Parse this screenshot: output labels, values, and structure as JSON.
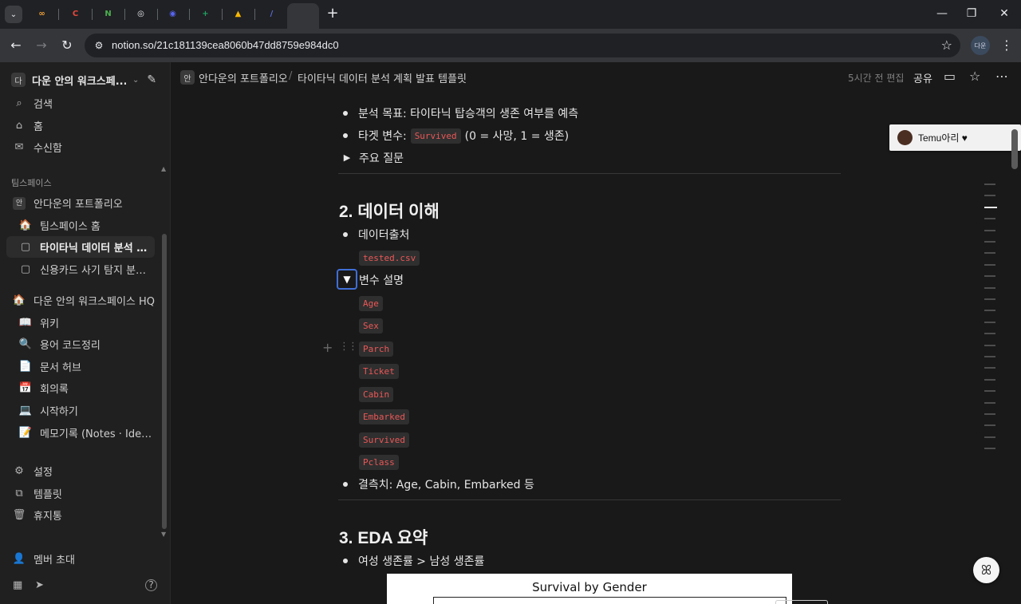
{
  "browser": {
    "url": "notion.so/21c181139cea8060b47dd8759e984dc0",
    "profile_label": "다운",
    "tabs": [
      {
        "icon": "infinity-icon",
        "glyph": "∞",
        "color": "#f2a33a"
      },
      {
        "icon": "c-app-icon",
        "glyph": "C",
        "color": "#e5483c"
      },
      {
        "icon": "n-app-icon",
        "glyph": "N",
        "color": "#4caf50"
      },
      {
        "icon": "chatgpt-icon",
        "glyph": "◎",
        "color": "#e8eaed"
      },
      {
        "icon": "discord-icon",
        "glyph": "◉",
        "color": "#5865f2"
      },
      {
        "icon": "sheets-icon",
        "glyph": "+",
        "color": "#1fa463"
      },
      {
        "icon": "drive-icon",
        "glyph": "▲",
        "color": "#f6b704"
      },
      {
        "icon": "pen-icon",
        "glyph": "/",
        "color": "#5b6dd8"
      },
      {
        "icon": "notion-icon",
        "glyph": "N",
        "color": "#ffffff"
      }
    ]
  },
  "sidebar": {
    "workspace_name": "다운 안의 워크스페...",
    "workspace_badge": "다",
    "top_items": [
      {
        "icon": "search-icon",
        "glyph": "⌕",
        "label": "검색"
      },
      {
        "icon": "home-icon",
        "glyph": "⌂",
        "label": "홈"
      },
      {
        "icon": "inbox-icon",
        "glyph": "✉",
        "label": "수신함"
      }
    ],
    "teamspace_section": "팀스페이스",
    "teamspace_name": "안다운의 포트폴리오",
    "teamspace_badge": "안",
    "teamspace_items": [
      {
        "icon": "house-emoji-icon",
        "glyph": "🏠",
        "label": "팀스페이스 홈"
      },
      {
        "icon": "page-icon",
        "glyph": "▢",
        "label": "타이타닉 데이터 분석 계..."
      },
      {
        "icon": "page-icon",
        "glyph": "▢",
        "label": "신용카드 사기 탐지 분석 ..."
      }
    ],
    "hq_name": "다운 안의 워크스페이스 HQ",
    "hq_items": [
      {
        "icon": "book-icon",
        "glyph": "📖",
        "label": "위키"
      },
      {
        "icon": "magnifier-icon",
        "glyph": "🔍",
        "label": "용어 코드정리"
      },
      {
        "icon": "document-icon",
        "glyph": "📄",
        "label": "문서 허브"
      },
      {
        "icon": "calendar-icon",
        "glyph": "📅",
        "label": "회의록"
      },
      {
        "icon": "laptop-icon",
        "glyph": "💻",
        "label": "시작하기"
      },
      {
        "icon": "memo-icon",
        "glyph": "📝",
        "label": "메모기록 (Notes · Ideas..."
      }
    ],
    "bottom_items": [
      {
        "icon": "gear-icon",
        "glyph": "⚙",
        "label": "설정"
      },
      {
        "icon": "template-icon",
        "glyph": "⧉",
        "label": "템플릿"
      },
      {
        "icon": "trash-icon",
        "glyph": "🗑",
        "label": "휴지통"
      }
    ],
    "invite_label": "멤버 초대"
  },
  "header": {
    "breadcrumb_badge": "안",
    "breadcrumb_parent": "안다운의 포트폴리오",
    "breadcrumb_separator": "/",
    "breadcrumb_current": "타이타닉 데이터 분석 계획 발표 템플릿",
    "edited": "5시간 전 편집",
    "share_label": "공유"
  },
  "content": {
    "goal_bullet": "분석 목표: 타이타닉 탑승객의 생존 여부를 예측",
    "target_prefix": "타겟 변수:",
    "target_code": "Survived",
    "target_suffix": "(0 = 사망, 1 = 생존)",
    "key_questions_toggle": "주요 질문",
    "section2_heading": "2. 데이터 이해",
    "data_source_bullet": "데이터출처",
    "data_source_file": "tested.csv",
    "variables_toggle": "변수 설명",
    "variables": [
      "Age",
      "Sex",
      "Parch",
      "Ticket",
      "Cabin",
      "Embarked",
      "Survived",
      "Pclass"
    ],
    "missing_bullet": "결측치: Age, Cabin, Embarked 등",
    "section3_heading": "3. EDA 요약",
    "eda_bullet": "여성 생존률 > 남성 생존률",
    "chart_title": "Survival by Gender"
  },
  "comment": {
    "user": "Temu아리 ♥"
  },
  "colors": {
    "code_text": "#eb5757",
    "code_bg": "#2f2f2f",
    "focus_ring": "#3f6fd8",
    "page_bg": "#191919",
    "sidebar_bg": "#202020"
  }
}
